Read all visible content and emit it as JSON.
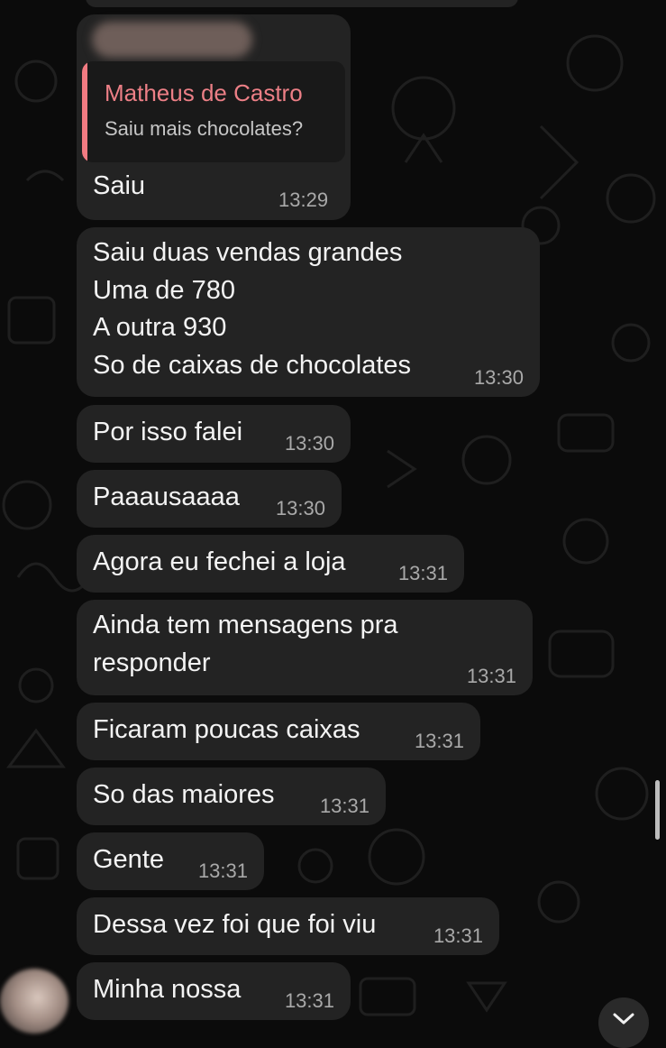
{
  "reply": {
    "author": "Matheus de Castro",
    "quoted_text": "Saiu mais chocolates?"
  },
  "messages": [
    {
      "text": "Saiu",
      "time": "13:29"
    },
    {
      "text": "Saiu duas vendas grandes\nUma de 780\nA outra 930\nSo de caixas de chocolates",
      "time": "13:30"
    },
    {
      "text": "Por isso falei",
      "time": "13:30"
    },
    {
      "text": "Paaausaaaa",
      "time": "13:30"
    },
    {
      "text": "Agora eu fechei a loja",
      "time": "13:31"
    },
    {
      "text": "Ainda tem mensagens pra\nresponder",
      "time": "13:31"
    },
    {
      "text": "Ficaram poucas caixas",
      "time": "13:31"
    },
    {
      "text": "So das maiores",
      "time": "13:31"
    },
    {
      "text": "Gente",
      "time": "13:31"
    },
    {
      "text": "Dessa vez foi que foi viu",
      "time": "13:31"
    },
    {
      "text": "Minha nossa",
      "time": "13:31"
    }
  ],
  "icons": {
    "scroll_down": "chevron-down-icon",
    "avatar": "avatar"
  },
  "colors": {
    "background": "#0b0b0b",
    "bubble": "#232323",
    "quote_accent": "#f27b82",
    "quote_author": "#ec7f86",
    "text": "#f3f3f3",
    "timestamp": "#a9a9a9"
  }
}
